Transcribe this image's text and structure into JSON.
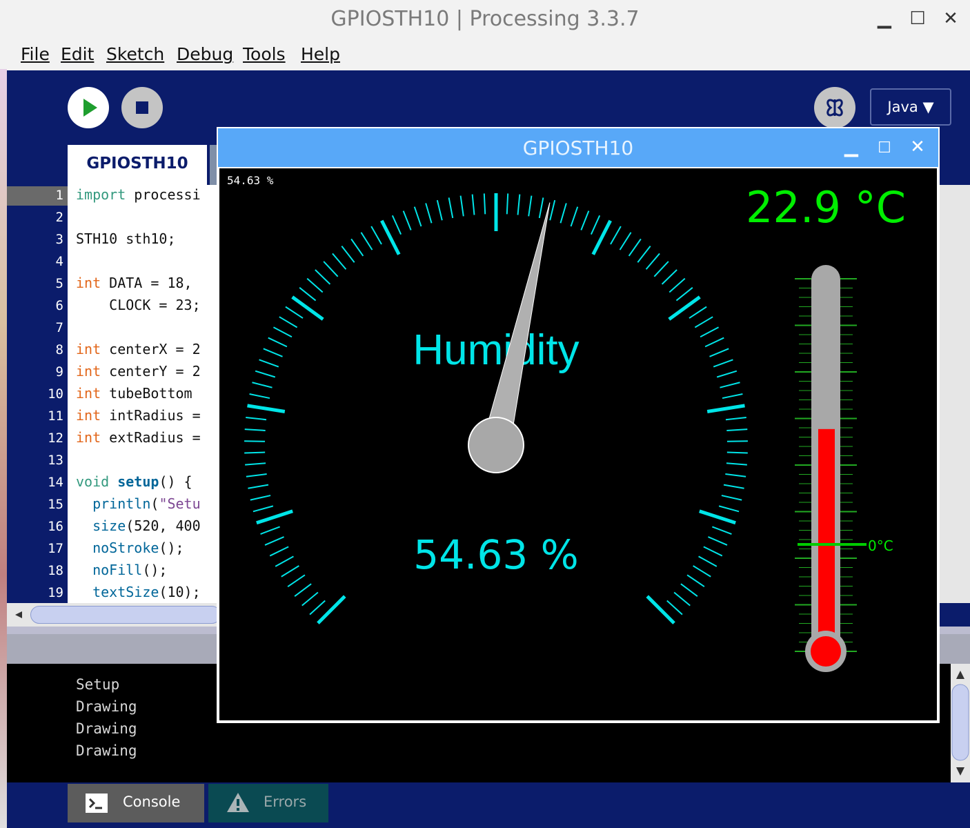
{
  "window": {
    "title": "GPIOSTH10 | Processing 3.3.7",
    "controls": {
      "minimize": "▁",
      "maximize": "☐",
      "close": "✕"
    }
  },
  "menu": [
    "File",
    "Edit",
    "Sketch",
    "Debug",
    "Tools",
    "Help"
  ],
  "toolbar": {
    "mode_label": "Java ▼"
  },
  "editor": {
    "tab_label": "GPIOSTH10",
    "line_numbers": [
      "1",
      "2",
      "3",
      "4",
      "5",
      "6",
      "7",
      "8",
      "9",
      "10",
      "11",
      "12",
      "13",
      "14",
      "15",
      "16",
      "17",
      "18",
      "19"
    ]
  },
  "console": {
    "lines": [
      "Setup",
      "Drawing",
      "Drawing",
      "Drawing"
    ],
    "tabs": {
      "console": "Console",
      "errors": "Errors"
    }
  },
  "sketch": {
    "title": "GPIOSTH10",
    "corner_readout": "54.63 %",
    "gauge_label": "Humidity",
    "humidity_value": 54.63,
    "humidity_text": "54.63 %",
    "temperature_text": "22.9 °C",
    "temperature_value": 22.9,
    "thermo_zero_label": "0°C",
    "colors": {
      "gauge": "#00e5e8",
      "temperature": "#00ee00",
      "mercury": "#ff0000",
      "needle": "#b0b0b0"
    }
  },
  "icons": {
    "run": "play-icon",
    "stop": "stop-icon",
    "debug": "butterfly-icon",
    "console": "terminal-icon",
    "errors": "warning-icon"
  }
}
